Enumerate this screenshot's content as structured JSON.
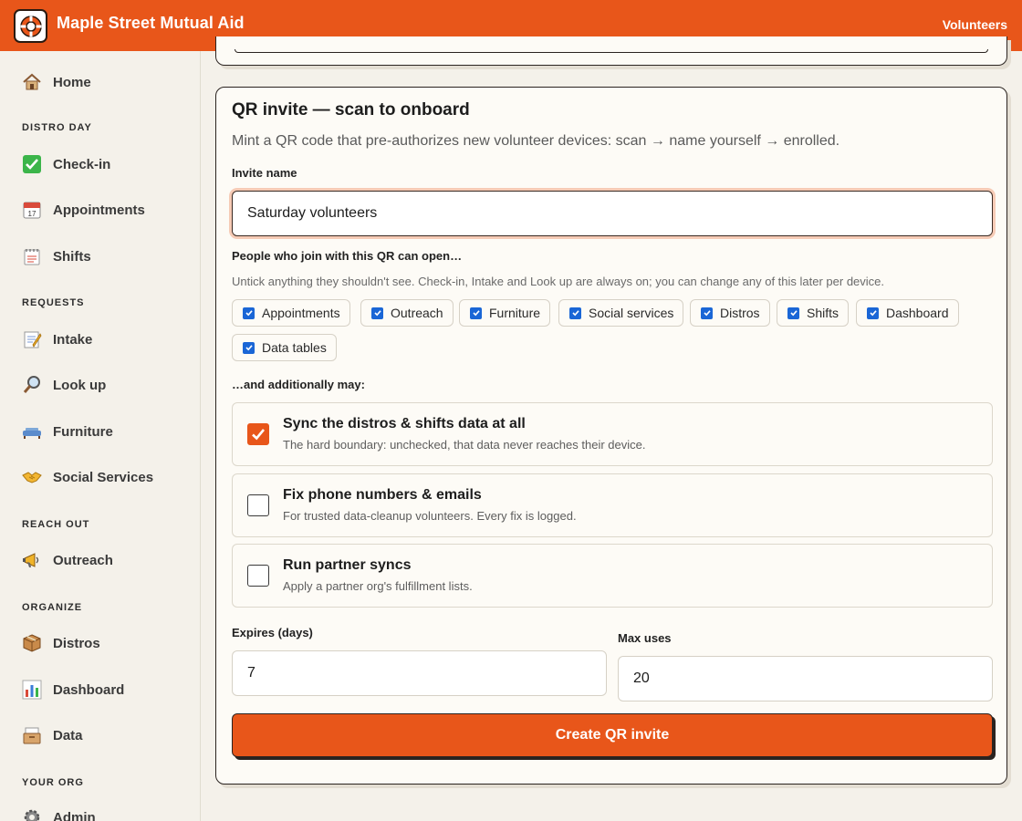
{
  "header": {
    "app_title": "Maple Street Mutual Aid",
    "right_link": "Volunteers",
    "brand_color": "#e8561a"
  },
  "sidebar": {
    "home": "Home",
    "sections": {
      "distro_day": "DISTRO DAY",
      "requests": "REQUESTS",
      "reach_out": "REACH OUT",
      "organize": "ORGANIZE",
      "your_org": "YOUR ORG"
    },
    "items": {
      "checkin": "Check-in",
      "appointments": "Appointments",
      "shifts": "Shifts",
      "intake": "Intake",
      "lookup": "Look up",
      "furniture": "Furniture",
      "social_services": "Social Services",
      "outreach": "Outreach",
      "distros": "Distros",
      "dashboard": "Dashboard",
      "data": "Data",
      "admin": "Admin"
    }
  },
  "invite": {
    "title": "QR invite — scan to onboard",
    "description": "Mint a QR code that pre-authorizes new volunteer devices: scan → name yourself → enrolled.",
    "name_label": "Invite name",
    "name_value": "Saturday volunteers",
    "access_label": "People who join with this QR can open…",
    "access_help": "Untick anything they shouldn't see. Check-in, Intake and Look up are always on; you can change any of this later per device.",
    "access_options": [
      "Appointments",
      "Outreach",
      "Furniture",
      "Social services",
      "Distros",
      "Shifts",
      "Dashboard",
      "Data tables"
    ],
    "additional_label": "…and additionally may:",
    "permissions": [
      {
        "title": "Sync the distros & shifts data at all",
        "desc": "The hard boundary: unchecked, that data never reaches their device.",
        "checked": true
      },
      {
        "title": "Fix phone numbers & emails",
        "desc": "For trusted data-cleanup volunteers. Every fix is logged.",
        "checked": false
      },
      {
        "title": "Run partner syncs",
        "desc": "Apply a partner org's fulfillment lists.",
        "checked": false
      }
    ],
    "expires_label": "Expires (days)",
    "expires_value": "7",
    "max_uses_label": "Max uses",
    "max_uses_value": "20",
    "create_button": "Create QR invite"
  }
}
